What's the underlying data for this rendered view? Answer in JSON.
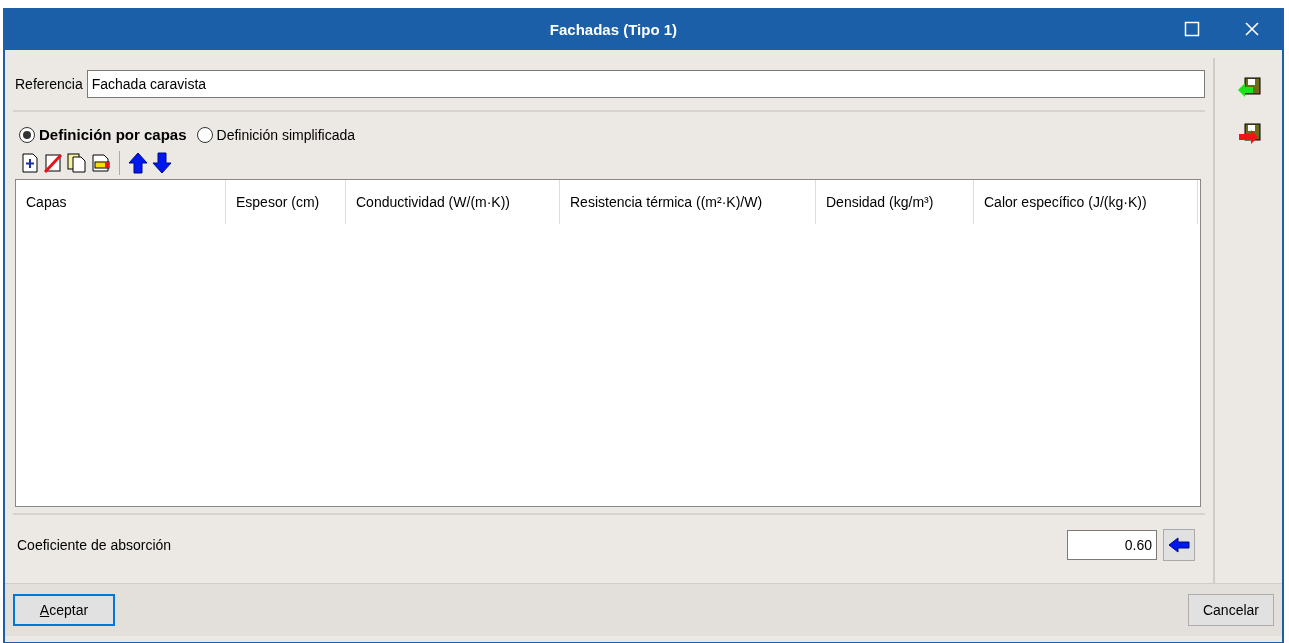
{
  "window": {
    "title": "Fachadas (Tipo 1)"
  },
  "reference": {
    "label": "Referencia",
    "value": "Fachada caravista"
  },
  "definition_modes": [
    {
      "label": "Definición por capas",
      "selected": true
    },
    {
      "label": "Definición simplificada",
      "selected": false
    }
  ],
  "table": {
    "columns": [
      "Capas",
      "Espesor (cm)",
      "Conductividad (W/(m·K))",
      "Resistencia térmica ((m²·K)/W)",
      "Densidad (kg/m³)",
      "Calor específico (J/(kg·K))"
    ]
  },
  "absorption": {
    "label": "Coeficiente de absorción",
    "value": "0.60"
  },
  "buttons": {
    "accept": "Aceptar",
    "cancel": "Cancelar"
  }
}
